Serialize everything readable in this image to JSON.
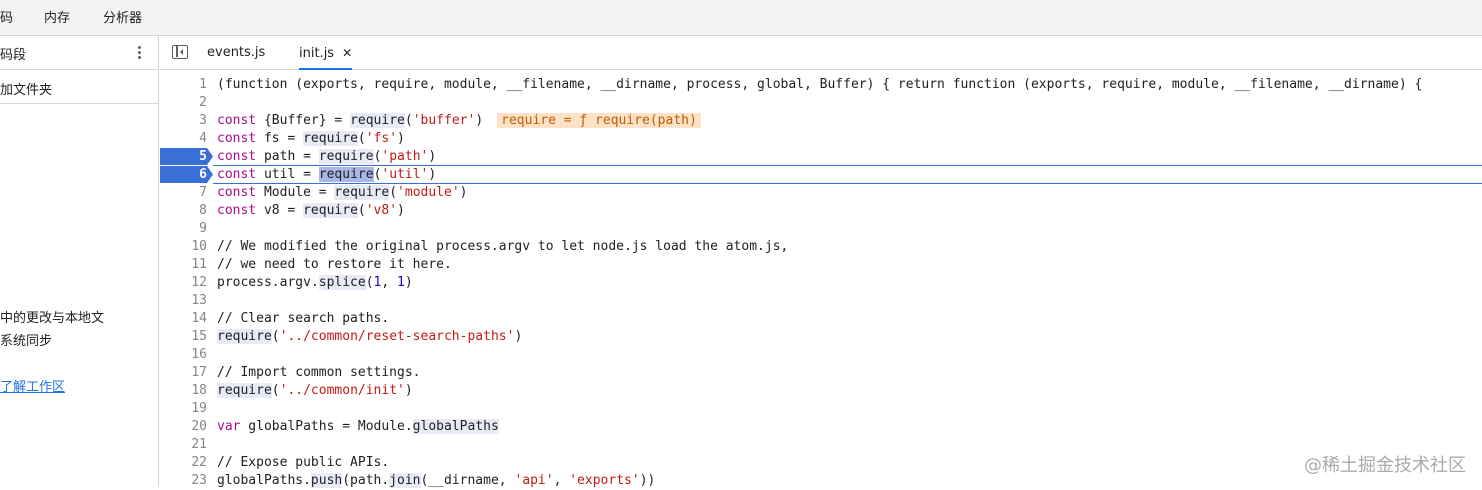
{
  "top_tabs": [
    "码",
    "内存",
    "分析器"
  ],
  "left_panel": {
    "title": "码段",
    "add_folder": "加文件夹",
    "ws_text_line1": "中的更改与本地文",
    "ws_text_line2": "系统同步",
    "ws_link": "了解工作区"
  },
  "editor": {
    "tabs": [
      {
        "label": "events.js",
        "active": false
      },
      {
        "label": "init.js",
        "active": true,
        "close": "✕"
      }
    ],
    "breakpoint_lines": [
      5,
      6
    ],
    "paused_line": 6,
    "inline_value": "require = ƒ require(path)"
  },
  "code_lines": [
    "1",
    "2",
    "3",
    "4",
    "5",
    "6",
    "7",
    "8",
    "9",
    "10",
    "11",
    "12",
    "13",
    "14",
    "15",
    "16",
    "17",
    "18",
    "19",
    "20",
    "21",
    "22",
    "23"
  ],
  "code_text": {
    "l1": "(function (exports, require, module, __filename, __dirname, process, global, Buffer) { return function (exports, require, module, __filename, __dirname) {",
    "l10": "// We modified the original process.argv to let node.js load the atom.js,",
    "l11": "// we need to restore it here.",
    "l14": "// Clear search paths.",
    "l17": "// Import common settings.",
    "l22": "// Expose public APIs."
  },
  "watermark": "@稀土掘金技术社区",
  "colors": {
    "breakpoint": "#3b6fd8",
    "link": "#1a73e8",
    "inline_bg": "#fde2c7"
  }
}
